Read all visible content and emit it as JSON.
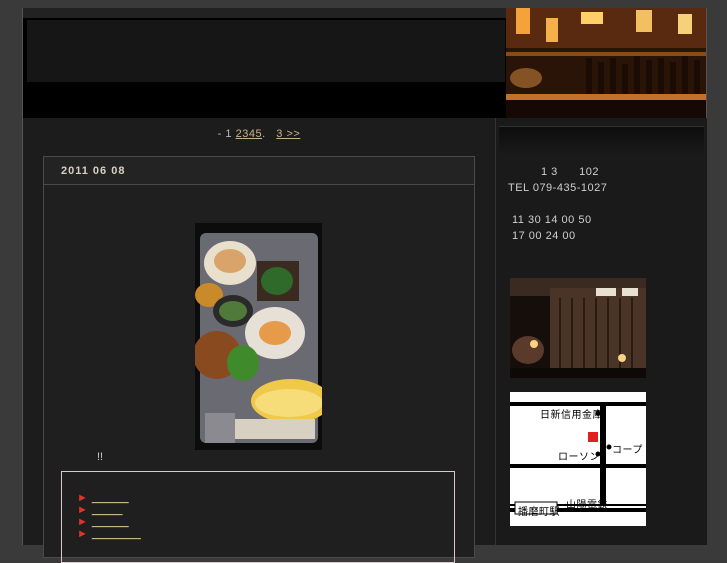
{
  "header": {},
  "pager": {
    "prefix": "- 1",
    "pages": [
      "2",
      "3",
      "4",
      "5"
    ],
    "sep": ".",
    "next": "3 >>"
  },
  "post": {
    "date": "2011 06 08",
    "body": "!!",
    "links": [
      "______",
      "_____",
      "______",
      "________"
    ]
  },
  "sidebar": {
    "address": "1 3      102",
    "tel": "TEL 079-435-1027",
    "hours_lunch": "11 30 14 00 50",
    "hours_dinner": "17 00 24 00",
    "map": {
      "bank": "日新信用金庫",
      "lawson": "ローソン",
      "coop": "コープ",
      "railway": "山陽電鉄",
      "station": "播磨町駅"
    }
  },
  "colors": {
    "link": "#c8b48a",
    "bullet": "#e0342a",
    "map_marker": "#e02020"
  }
}
